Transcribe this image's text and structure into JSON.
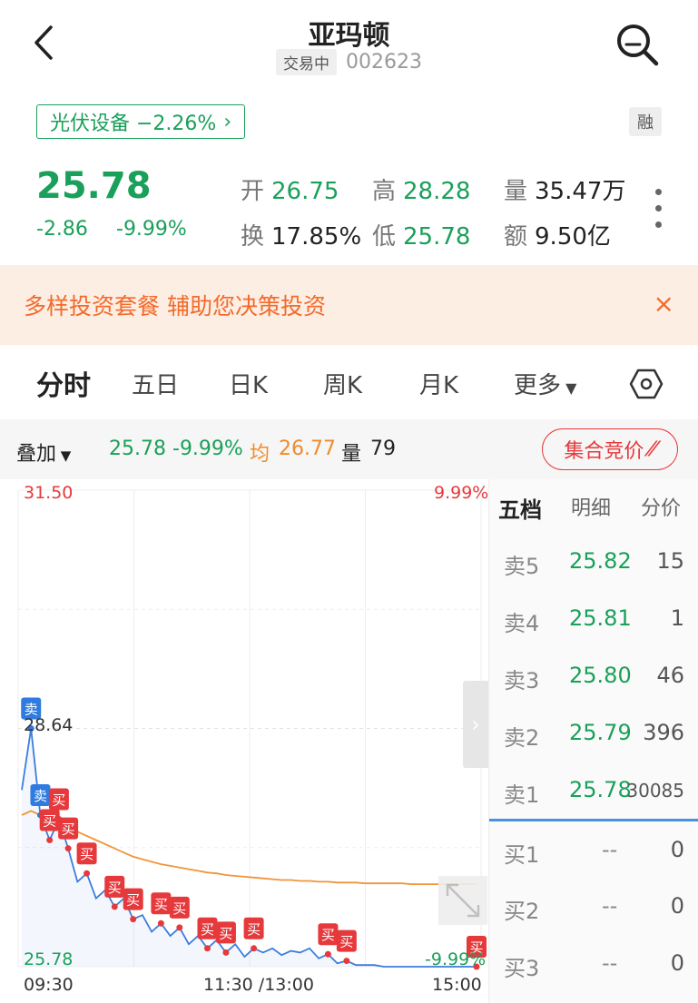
{
  "header": {
    "title": "亚玛顿",
    "status": "交易中",
    "code": "002623"
  },
  "sector": {
    "label": "光伏设备 −2.26%",
    "arrow": "›"
  },
  "rong_badge": "融",
  "quote": {
    "price": "25.78",
    "change": "-2.86",
    "change_pct": "-9.99%",
    "stats": [
      {
        "label": "开",
        "value": "26.75",
        "color": "green"
      },
      {
        "label": "高",
        "value": "28.28",
        "color": "green"
      },
      {
        "label": "量",
        "value": "35.47万",
        "color": "dark"
      },
      {
        "label": "换",
        "value": "17.85%",
        "color": "dark"
      },
      {
        "label": "低",
        "value": "25.78",
        "color": "green"
      },
      {
        "label": "额",
        "value": "9.50亿",
        "color": "dark"
      }
    ]
  },
  "banner": {
    "text": "多样投资套餐  辅助您决策投资",
    "close": "×"
  },
  "tabs": [
    "分时",
    "五日",
    "日K",
    "周K",
    "月K",
    "更多"
  ],
  "overlay": {
    "label": "叠加",
    "price": "25.78",
    "pct": "-9.99%",
    "avg_label": "均",
    "avg": "26.77",
    "vol_label": "量",
    "vol": "79",
    "auction_button": "集合竞价"
  },
  "chart_data": {
    "type": "line",
    "series": [
      {
        "name": "price",
        "color": "#3b7ddd",
        "values": [
          27.9,
          28.64,
          27.6,
          27.3,
          27.55,
          27.2,
          26.8,
          26.9,
          26.6,
          26.7,
          26.5,
          26.6,
          26.35,
          26.4,
          26.2,
          26.3,
          26.15,
          26.25,
          26.05,
          26.15,
          26.0,
          26.1,
          25.95,
          26.05,
          25.9,
          26.0,
          25.95,
          26.0,
          25.92,
          25.97,
          25.95,
          26.0,
          25.88,
          25.93,
          25.82,
          25.85,
          25.8,
          25.8,
          25.8,
          25.78,
          25.78,
          25.78,
          25.78,
          25.78,
          25.78,
          25.78,
          25.78,
          25.78,
          25.78,
          25.78
        ]
      },
      {
        "name": "avg",
        "color": "#f0953a",
        "values": [
          27.6,
          27.65,
          27.6,
          27.55,
          27.5,
          27.45,
          27.4,
          27.35,
          27.3,
          27.25,
          27.2,
          27.15,
          27.1,
          27.07,
          27.04,
          27.01,
          26.99,
          26.97,
          26.95,
          26.93,
          26.91,
          26.9,
          26.88,
          26.87,
          26.86,
          26.85,
          26.84,
          26.83,
          26.82,
          26.82,
          26.81,
          26.81,
          26.8,
          26.8,
          26.79,
          26.79,
          26.79,
          26.78,
          26.78,
          26.78,
          26.78,
          26.78,
          26.77,
          26.77,
          26.77,
          26.77,
          26.77,
          26.77,
          26.77,
          26.77
        ]
      }
    ],
    "ylim": [
      25.78,
      31.5
    ],
    "y_top_label": "31.50",
    "y_top_pct": "9.99%",
    "y_mid_label": "28.64",
    "y_bottom_label": "25.78",
    "y_bottom_pct": "-9.99%",
    "x_labels": [
      "09:30",
      "11:30 /13:00",
      "15:00"
    ],
    "signals": [
      {
        "text": "卖",
        "kind": "sell",
        "i": 1
      },
      {
        "text": "卖",
        "kind": "sell",
        "i": 2
      },
      {
        "text": "买",
        "kind": "buy",
        "i": 3
      },
      {
        "text": "买",
        "kind": "buy",
        "i": 4
      },
      {
        "text": "买",
        "kind": "buy",
        "i": 5
      },
      {
        "text": "买",
        "kind": "buy",
        "i": 7
      },
      {
        "text": "买",
        "kind": "buy",
        "i": 10
      },
      {
        "text": "买",
        "kind": "buy",
        "i": 12
      },
      {
        "text": "买",
        "kind": "buy",
        "i": 15
      },
      {
        "text": "买",
        "kind": "buy",
        "i": 17
      },
      {
        "text": "买",
        "kind": "buy",
        "i": 20
      },
      {
        "text": "买",
        "kind": "buy",
        "i": 22
      },
      {
        "text": "买",
        "kind": "buy",
        "i": 25
      },
      {
        "text": "买",
        "kind": "buy",
        "i": 33
      },
      {
        "text": "买",
        "kind": "buy",
        "i": 35
      },
      {
        "text": "买",
        "kind": "buy",
        "i": 49
      }
    ]
  },
  "orderbook": {
    "tabs": [
      "五档",
      "明细",
      "分价"
    ],
    "asks": [
      {
        "label": "卖5",
        "price": "25.82",
        "vol": "15"
      },
      {
        "label": "卖4",
        "price": "25.81",
        "vol": "1"
      },
      {
        "label": "卖3",
        "price": "25.80",
        "vol": "46"
      },
      {
        "label": "卖2",
        "price": "25.79",
        "vol": "396"
      },
      {
        "label": "卖1",
        "price": "25.78",
        "vol": "30085"
      }
    ],
    "bids": [
      {
        "label": "买1",
        "price": "--",
        "vol": "0"
      },
      {
        "label": "买2",
        "price": "--",
        "vol": "0"
      },
      {
        "label": "买3",
        "price": "--",
        "vol": "0"
      }
    ]
  },
  "colors": {
    "up": "#e6393c",
    "down": "#1aa05a",
    "accent": "#f26a2b",
    "line": "#3b7ddd",
    "avg": "#f0953a"
  },
  "icons": [
    "back-arrow-icon",
    "search-icon",
    "more-dots-icon",
    "settings-hex-icon",
    "chevron-right-icon",
    "expand-icon",
    "close-icon",
    "dropdown-icon"
  ]
}
